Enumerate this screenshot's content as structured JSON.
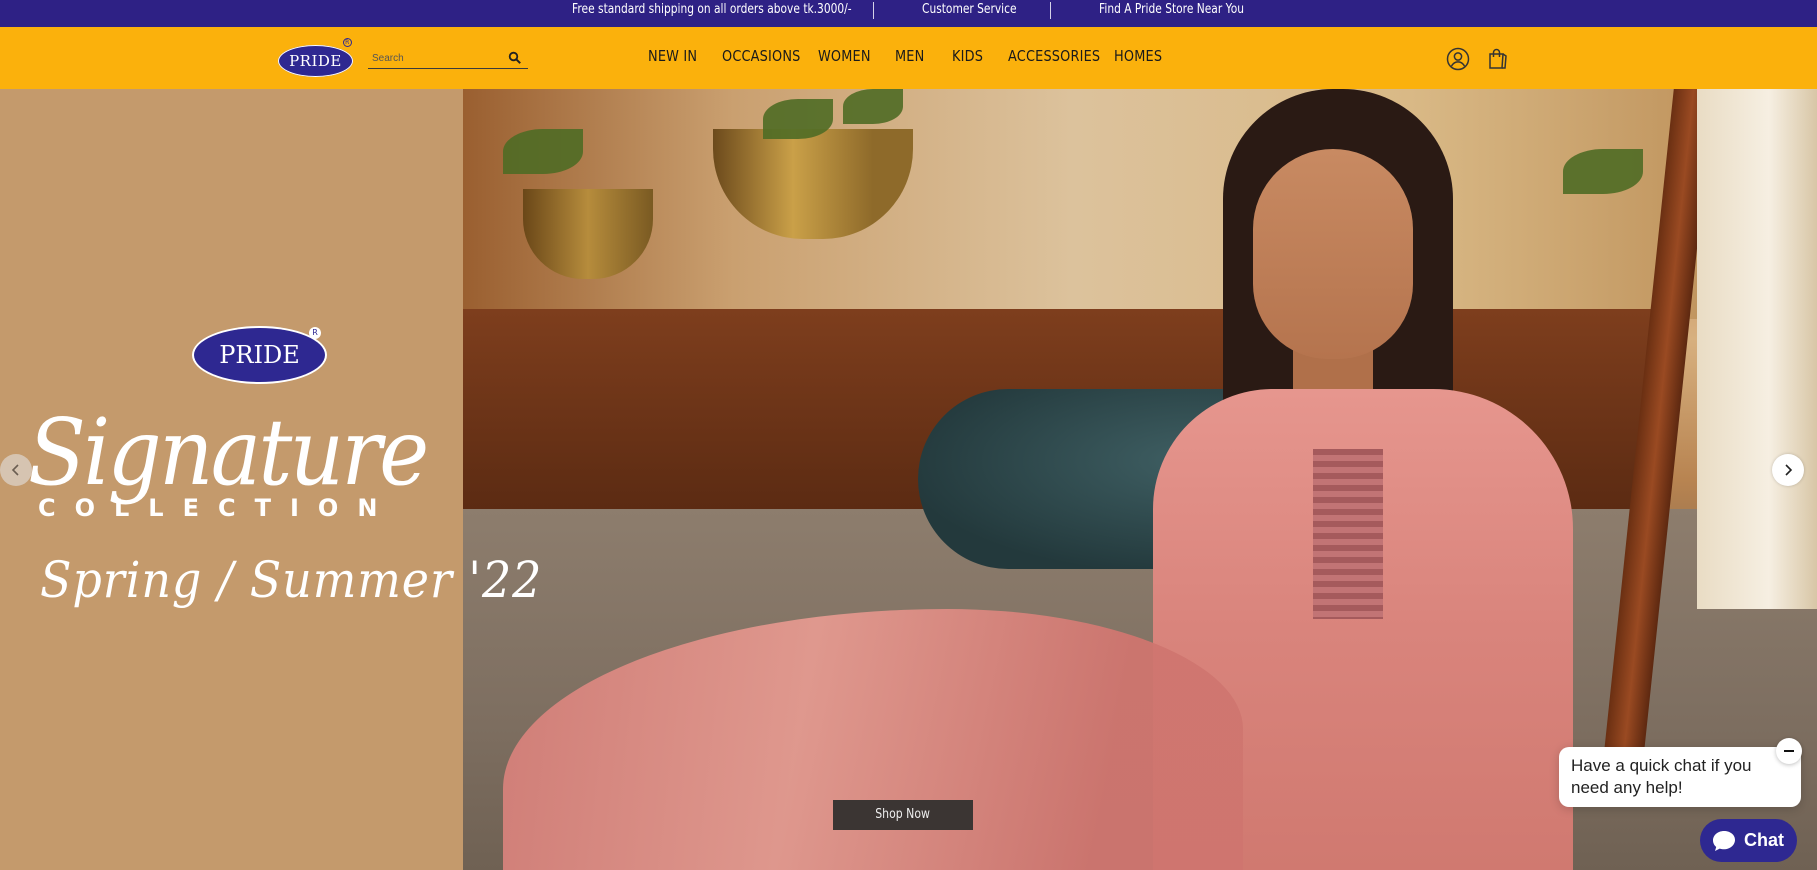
{
  "topbar": {
    "shipping": "Free standard shipping on all orders above tk.3000/-",
    "customer_service": "Customer Service",
    "store_finder": "Find A Pride Store Near You"
  },
  "header": {
    "logo_text": "PRIDE",
    "logo_reg": "R",
    "search_placeholder": "Search",
    "nav": [
      "NEW IN",
      "OCCASIONS",
      "WOMEN",
      "MEN",
      "KIDS",
      "ACCESSORIES",
      "HOMES"
    ],
    "icons": [
      "user-icon",
      "shopping-bag-icon"
    ]
  },
  "hero": {
    "brand": "PRIDE",
    "brand_reg": "R",
    "title": "Signature",
    "subtitle": "COLLECTION",
    "season": "Spring / Summer '22",
    "cta": "Shop Now"
  },
  "chat": {
    "message": "Have a quick chat if you need any help!",
    "button": "Chat"
  },
  "colors": {
    "topbar": "#2e2185",
    "header": "#fbb10c",
    "hero_panel": "#c49a6c",
    "brand": "#2e2891"
  }
}
